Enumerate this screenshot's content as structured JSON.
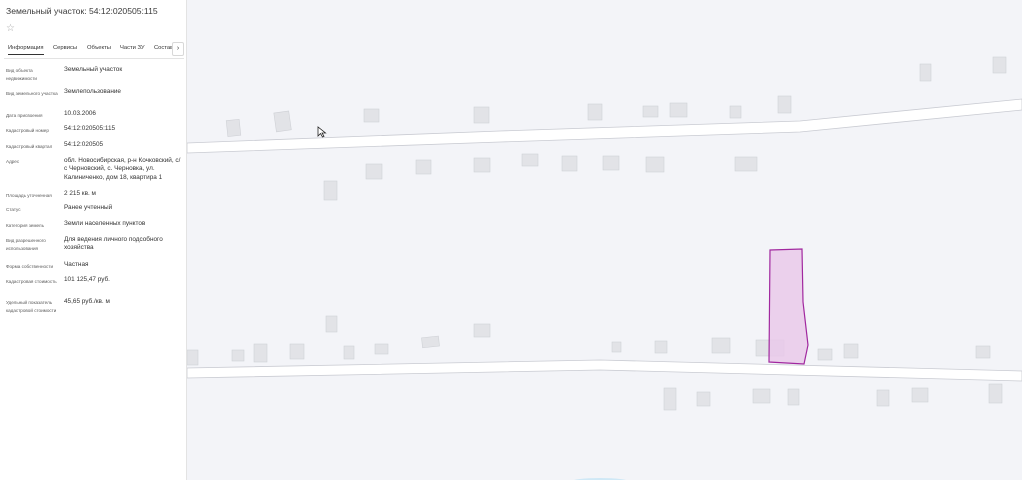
{
  "panel": {
    "title": "Земельный участок: 54:12:020505:115",
    "favorite_icon": "star-outline-icon",
    "tabs": [
      "Информация",
      "Сервисы",
      "Объекты",
      "Части ЗУ",
      "Состав"
    ],
    "active_tab": "Информация",
    "next_tab_icon": "chevron-right-icon",
    "rows": [
      {
        "label": "Вид объекта недвижимости",
        "value": "Земельный участок"
      },
      {
        "label": "Вид земельного участка",
        "value": "Землепользование"
      },
      {
        "label": "Дата присвоения",
        "value": "10.03.2006"
      },
      {
        "label": "Кадастровый номер",
        "value": "54:12:020505:115"
      },
      {
        "label": "Кадастровый квартал",
        "value": "54:12:020505"
      },
      {
        "label": "Адрес",
        "value": "обл. Новосибирская, р-н Кочковский, с/с Черновский, с. Черновка, ул. Калиниченко, дом 18, квартира 1"
      },
      {
        "label": "Площадь уточненная",
        "value": "2 215 кв. м"
      },
      {
        "label": "Статус",
        "value": "Ранее учтенный"
      },
      {
        "label": "Категория земель",
        "value": "Земли населенных пунктов"
      },
      {
        "label": "Вид разрешенного использования",
        "value": "Для ведения личного подсобного хозяйства"
      },
      {
        "label": "Форма собственности",
        "value": "Частная"
      },
      {
        "label": "Кадастровая стоимость",
        "value": "101 125,47 руб."
      },
      {
        "label": "Удельный показатель кадастровой стоимости",
        "value": "45,65 руб./кв. м"
      }
    ]
  },
  "map": {
    "background_color": "#f3f4f8",
    "road_color": "#ffffff",
    "building_color": "#e2e3e7",
    "selected_parcel_fill": "#e9c9ea",
    "selected_parcel_stroke": "#a1289f",
    "cursor_icon": "mouse-pointer-icon"
  }
}
